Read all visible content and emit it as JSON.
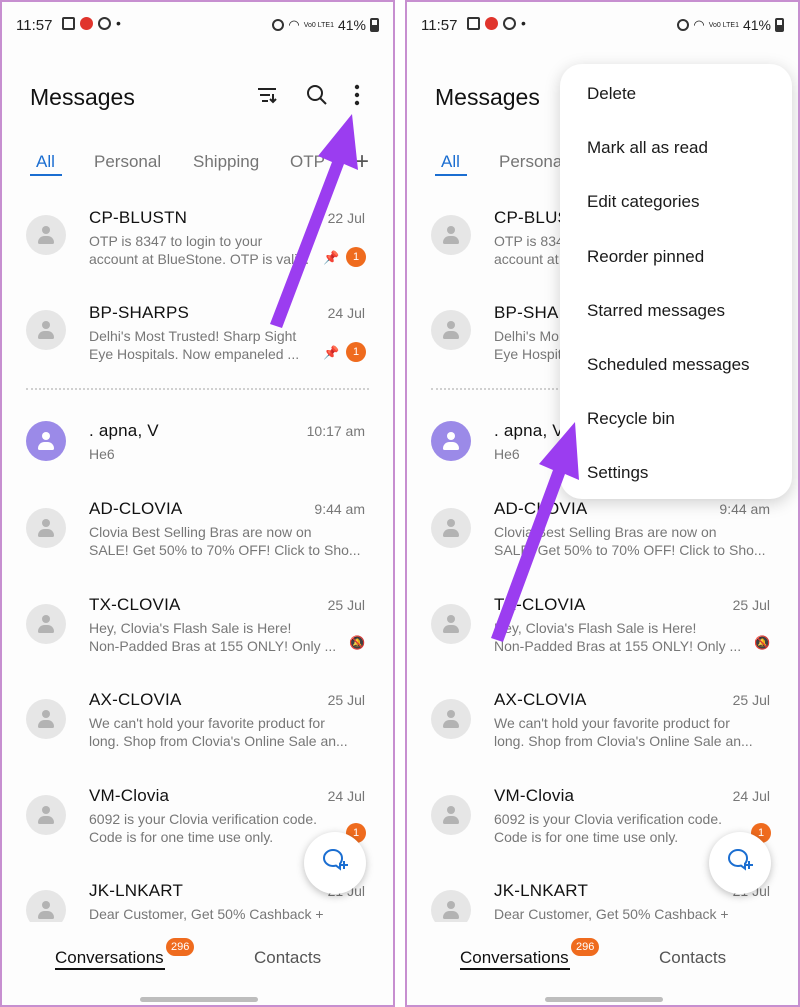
{
  "status_bar": {
    "time": "11:57",
    "dot": "•",
    "battery": "41%",
    "lte": "Vo0 LTE1"
  },
  "app_title": "Messages",
  "tabs": [
    {
      "label": "All"
    },
    {
      "label": "Personal"
    },
    {
      "label": "Shipping"
    },
    {
      "label": "OTP"
    }
  ],
  "tabs_right": [
    {
      "label": "All"
    },
    {
      "label": "Persona"
    }
  ],
  "tab_add_glyph": "+",
  "conversations": [
    {
      "name": "CP-BLUSTN",
      "date": "22 Jul",
      "line1": "OTP is 8347 to login to your",
      "line2": "account at BlueStone. OTP is vali...",
      "badge": "1"
    },
    {
      "name": "BP-SHARPS",
      "date": "24 Jul",
      "line1": "Delhi's Most Trusted! Sharp Sight",
      "line2": "Eye Hospitals. Now empaneled ...",
      "badge": "1"
    },
    {
      "name": ". apna, V",
      "date": "10:17 am",
      "line1": "He6",
      "line2": ""
    },
    {
      "name": "AD-CLOVIA",
      "date": "9:44 am",
      "line1": "Clovia Best Selling Bras are now on",
      "line2": "SALE! Get 50% to 70% OFF! Click to Sho..."
    },
    {
      "name": "TX-CLOVIA",
      "date": "25 Jul",
      "line1": "Hey, Clovia's Flash Sale is Here!",
      "line2": "Non-Padded Bras at 155 ONLY! Only ..."
    },
    {
      "name": "AX-CLOVIA",
      "date": "25 Jul",
      "line1": "We can't hold your favorite product for",
      "line2": "long. Shop from Clovia's Online Sale an..."
    },
    {
      "name": "VM-Clovia",
      "date": "24 Jul",
      "line1": "6092 is your Clovia verification code.",
      "line2": "Code is for one time use only.",
      "badge": "1"
    },
    {
      "name": "JK-LNKART",
      "date": "21 Jul",
      "line1": "Dear Customer, Get 50% Cashback +",
      "line2": ""
    }
  ],
  "conversations_right": [
    {
      "name": "CP-BLUS",
      "line1": "OTP is 834",
      "line2": "account at"
    },
    {
      "name": "BP-SHA",
      "line1": "Delhi's Mo",
      "line2": "Eye Hospit"
    },
    {
      "name": ". apna, V",
      "line1": "He6"
    }
  ],
  "bottom_nav": {
    "conversations": "Conversations",
    "contacts": "Contacts",
    "badge": "296"
  },
  "menu": {
    "items": [
      "Delete",
      "Mark all as read",
      "Edit categories",
      "Reorder pinned",
      "Starred messages",
      "Scheduled messages",
      "Recycle bin",
      "Settings"
    ]
  },
  "icons": {
    "filter": "filter-icon",
    "search": "search-icon",
    "more": "more-options-icon",
    "pin": "pin-icon",
    "mute": "mute-icon",
    "new_message": "new-message-icon"
  },
  "colors": {
    "accent": "#1b6ed1",
    "badge": "#ef6b1e",
    "annotation_arrow": "#9b3df0",
    "avatar_purple": "#9b8ae8",
    "frame": "#c78fd0"
  }
}
